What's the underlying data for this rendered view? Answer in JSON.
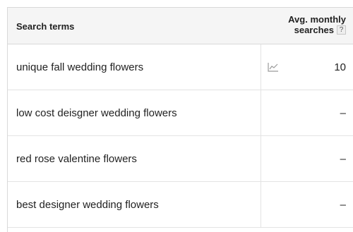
{
  "table": {
    "header": {
      "term_label": "Search terms",
      "searches_label_line1": "Avg. monthly",
      "searches_label_line2": "searches",
      "help_label": "?"
    },
    "rows": [
      {
        "term": "unique fall wedding flowers",
        "searches": "10",
        "has_trend_icon": true
      },
      {
        "term": "low cost deisgner wedding flowers",
        "searches": "–",
        "has_trend_icon": false
      },
      {
        "term": "red rose valentine flowers",
        "searches": "–",
        "has_trend_icon": false
      },
      {
        "term": "best designer wedding flowers",
        "searches": "–",
        "has_trend_icon": false
      }
    ],
    "icons": {
      "trend": "line-chart-icon",
      "help": "help-icon"
    }
  }
}
